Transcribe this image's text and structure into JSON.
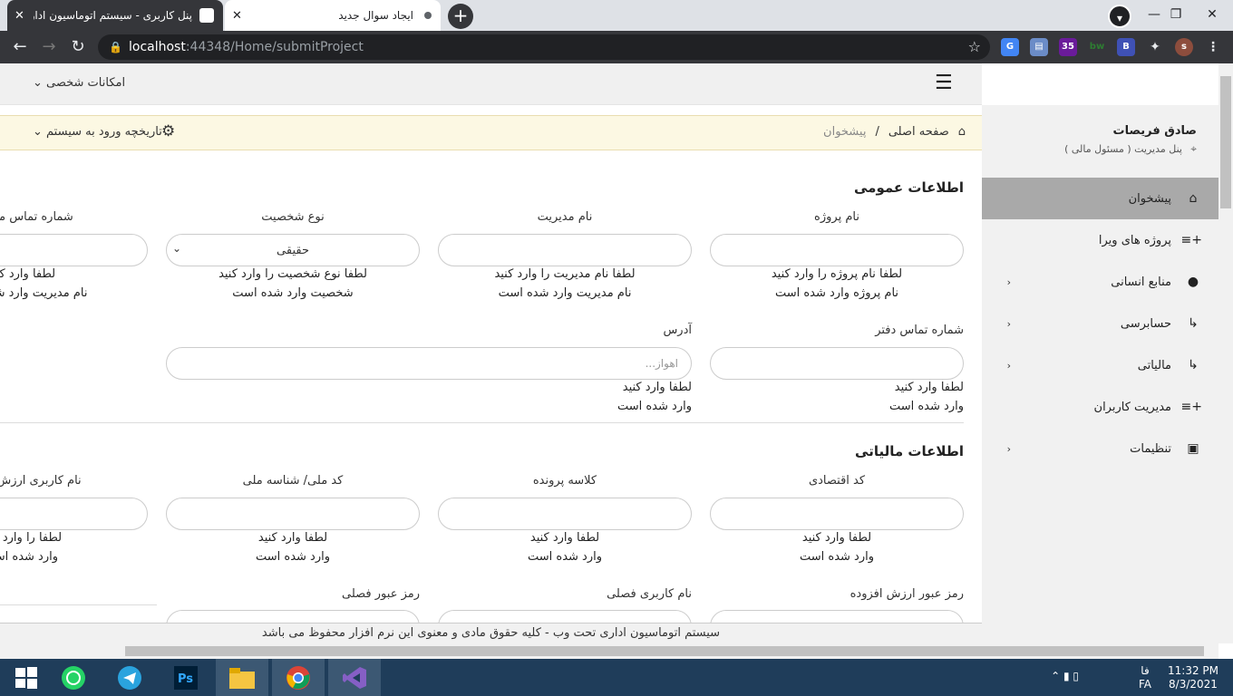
{
  "browser": {
    "tabs": [
      {
        "title": "پنل کاربری - سیستم اتوماسیون اداری",
        "active": true
      },
      {
        "title": "ایجاد سوال جدید",
        "active": false
      }
    ],
    "new_tab": "+",
    "url_host": "localhost",
    "url_path": ":44348/Home/submitProject",
    "profile_initial": "s",
    "ext_badge": "35"
  },
  "topbar": {
    "personal_menu": "امکانات شخصی"
  },
  "breadcrumb": {
    "home": "صفحه اصلی",
    "sep": "/",
    "current": "پیشخوان",
    "login_history": "تاریخچه ورود به سیستم"
  },
  "sidebar": {
    "user_name": "صادق فریصات",
    "user_role": "پنل مدیریت ( مسئول مالی )",
    "items": [
      {
        "label": "پیشخوان",
        "icon": "home-icon",
        "active": true
      },
      {
        "label": "پروژه های ویرا",
        "icon": "plus-list-icon"
      },
      {
        "label": "منابع انسانی",
        "icon": "user-icon",
        "submenu": true
      },
      {
        "label": "حسابرسی",
        "icon": "arrow-icon",
        "submenu": true
      },
      {
        "label": "مالیاتی",
        "icon": "arrow-icon",
        "submenu": true
      },
      {
        "label": "مدیریت کاربران",
        "icon": "plus-list-icon"
      },
      {
        "label": "تنظیمات",
        "icon": "settings-box-icon",
        "submenu": true
      }
    ]
  },
  "general": {
    "title": "اطلاعات عمومی",
    "project_name": {
      "label": "نام پروژه",
      "msg1": "لطفا نام پروژه را وارد کنید",
      "msg2": "نام پروژه وارد شده است"
    },
    "manager_name": {
      "label": "نام مدیریت",
      "msg1": "لطفا نام مدیریت را وارد کنید",
      "msg2": "نام مدیریت وارد شده است"
    },
    "person_type": {
      "label": "نوع شخصیت",
      "value": "حقیقی",
      "msg1": "لطفا نوع شخصیت را وارد کنید",
      "msg2": "شخصیت وارد شده است"
    },
    "manager_phone": {
      "label": "شماره تماس مدیریت",
      "msg1": "لطفا وارد کنید",
      "msg2": "نام مدیریت وارد شده است"
    },
    "office_phone": {
      "label": "شماره تماس دفتر",
      "msg1": "لطفا وارد کنید",
      "msg2": "وارد شده است"
    },
    "address": {
      "label": "آدرس",
      "placeholder": "اهواز...",
      "msg1": "لطفا وارد کنید",
      "msg2": "وارد شده است"
    }
  },
  "tax": {
    "title": "اطلاعات مالیاتی",
    "economic_code": {
      "label": "کد اقتصادی",
      "msg1": "لطفا وارد کنید",
      "msg2": "وارد شده است"
    },
    "file_class": {
      "label": "کلاسه پرونده",
      "msg1": "لطفا وارد کنید",
      "msg2": "وارد شده است"
    },
    "national_id": {
      "label": "کد ملی/ شناسه ملی",
      "msg1": "لطفا وارد کنید",
      "msg2": "وارد شده است"
    },
    "vat_username": {
      "label": "نام کاربری ارزش افزوده",
      "msg1": "لطفا را وارد کنید",
      "msg2": "وارد شده است"
    },
    "vat_password": {
      "label": "رمز عبور ارزش افزوده"
    },
    "season_username": {
      "label": "نام کاربری فصلی"
    },
    "season_password": {
      "label": "رمز عبور فصلی"
    }
  },
  "footer": {
    "text": "سیستم اتوماسیون اداری تحت وب - کلیه حقوق مادی و معنوی این نرم افزار محفوظ می باشد"
  },
  "taskbar": {
    "lang_top": "فا",
    "lang_bottom": "FA",
    "time": "11:32 PM",
    "date": "8/3/2021"
  }
}
